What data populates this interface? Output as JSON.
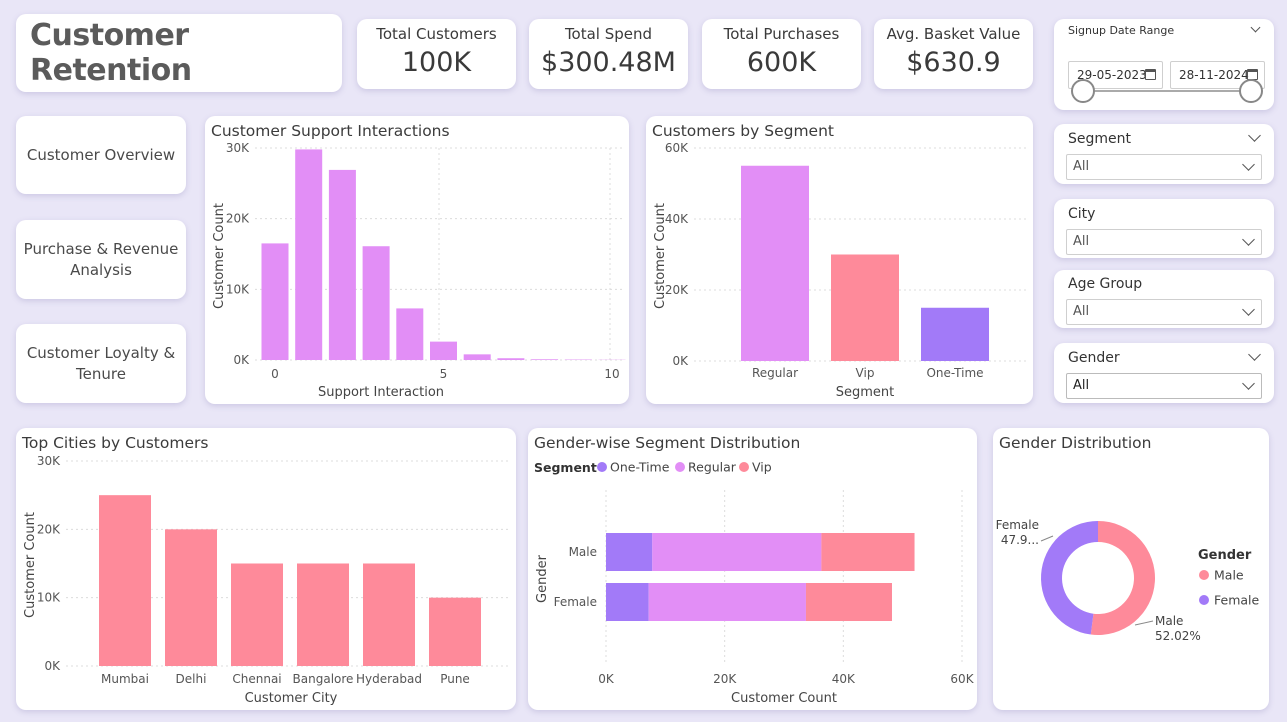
{
  "header": {
    "title": "Customer Retention"
  },
  "kpis": [
    {
      "label": "Total Customers",
      "value": "100K"
    },
    {
      "label": "Total Spend",
      "value": "$300.48M"
    },
    {
      "label": "Total Purchases",
      "value": "600K"
    },
    {
      "label": "Avg. Basket Value",
      "value": "$630.9"
    }
  ],
  "nav": {
    "overview": "Customer Overview",
    "purchase_line1": "Purchase & Revenue",
    "purchase_line2": "Analysis",
    "loyalty_line1": "Customer Loyalty &",
    "loyalty_line2": "Tenure"
  },
  "slicers": {
    "date": {
      "label": "Signup Date Range",
      "start": "29-05-2023",
      "end": "28-11-2024"
    },
    "segment": {
      "label": "Segment",
      "value": "All"
    },
    "city": {
      "label": "City",
      "value": "All"
    },
    "age_group": {
      "label": "Age Group",
      "value": "All"
    },
    "gender": {
      "label": "Gender",
      "value": "All"
    }
  },
  "colors": {
    "regular": "#e28ef6",
    "vip": "#fe8a9a",
    "one_time": "#a27af8",
    "bar_pink": "#fe8a9a"
  },
  "chart_data": [
    {
      "type": "bar",
      "title": "Customer Support Interactions",
      "xlabel": "Support Interaction",
      "ylabel": "Customer Count",
      "x": [
        0,
        1,
        2,
        3,
        4,
        5,
        6,
        7,
        8,
        9,
        10
      ],
      "values": [
        16500,
        29800,
        26900,
        16100,
        7300,
        2600,
        800,
        250,
        100,
        60,
        30
      ],
      "ylim": [
        0,
        30000
      ],
      "yticks": [
        "0K",
        "10K",
        "20K",
        "30K"
      ],
      "xticks": [
        "0",
        "5",
        "10"
      ]
    },
    {
      "type": "bar",
      "title": "Customers by Segment",
      "xlabel": "Segment",
      "ylabel": "Customer Count",
      "categories": [
        "Regular",
        "Vip",
        "One-Time"
      ],
      "values": [
        55000,
        30000,
        15000
      ],
      "ylim": [
        0,
        60000
      ],
      "yticks": [
        "0K",
        "20K",
        "40K",
        "60K"
      ]
    },
    {
      "type": "bar",
      "title": "Top Cities by Customers",
      "xlabel": "Customer City",
      "ylabel": "Customer Count",
      "categories": [
        "Mumbai",
        "Delhi",
        "Chennai",
        "Bangalore",
        "Hyderabad",
        "Pune"
      ],
      "values": [
        25000,
        20000,
        15000,
        15000,
        15000,
        10000
      ],
      "ylim": [
        0,
        30000
      ],
      "yticks": [
        "0K",
        "10K",
        "20K",
        "30K"
      ]
    },
    {
      "type": "bar",
      "orientation": "horizontal",
      "stacked": true,
      "title": "Gender-wise Segment Distribution",
      "xlabel": "Customer Count",
      "ylabel": "Gender",
      "legend_title": "Segment",
      "categories": [
        "Male",
        "Female"
      ],
      "series": [
        {
          "name": "One-Time",
          "values": [
            7800,
            7200
          ]
        },
        {
          "name": "Regular",
          "values": [
            28500,
            26500
          ]
        },
        {
          "name": "Vip",
          "values": [
            15700,
            14500
          ]
        }
      ],
      "xlim": [
        0,
        60000
      ],
      "xticks": [
        "0K",
        "20K",
        "40K",
        "60K"
      ],
      "legend_position": "top-left"
    },
    {
      "type": "pie",
      "donut": true,
      "title": "Gender Distribution",
      "legend_title": "Gender",
      "legend_position": "right",
      "labels": [
        "Male",
        "Female"
      ],
      "values": [
        52.02,
        47.98
      ],
      "data_labels": [
        {
          "name": "Male",
          "value": "52.02%"
        },
        {
          "name": "Female",
          "value": "47.9..."
        }
      ]
    }
  ]
}
